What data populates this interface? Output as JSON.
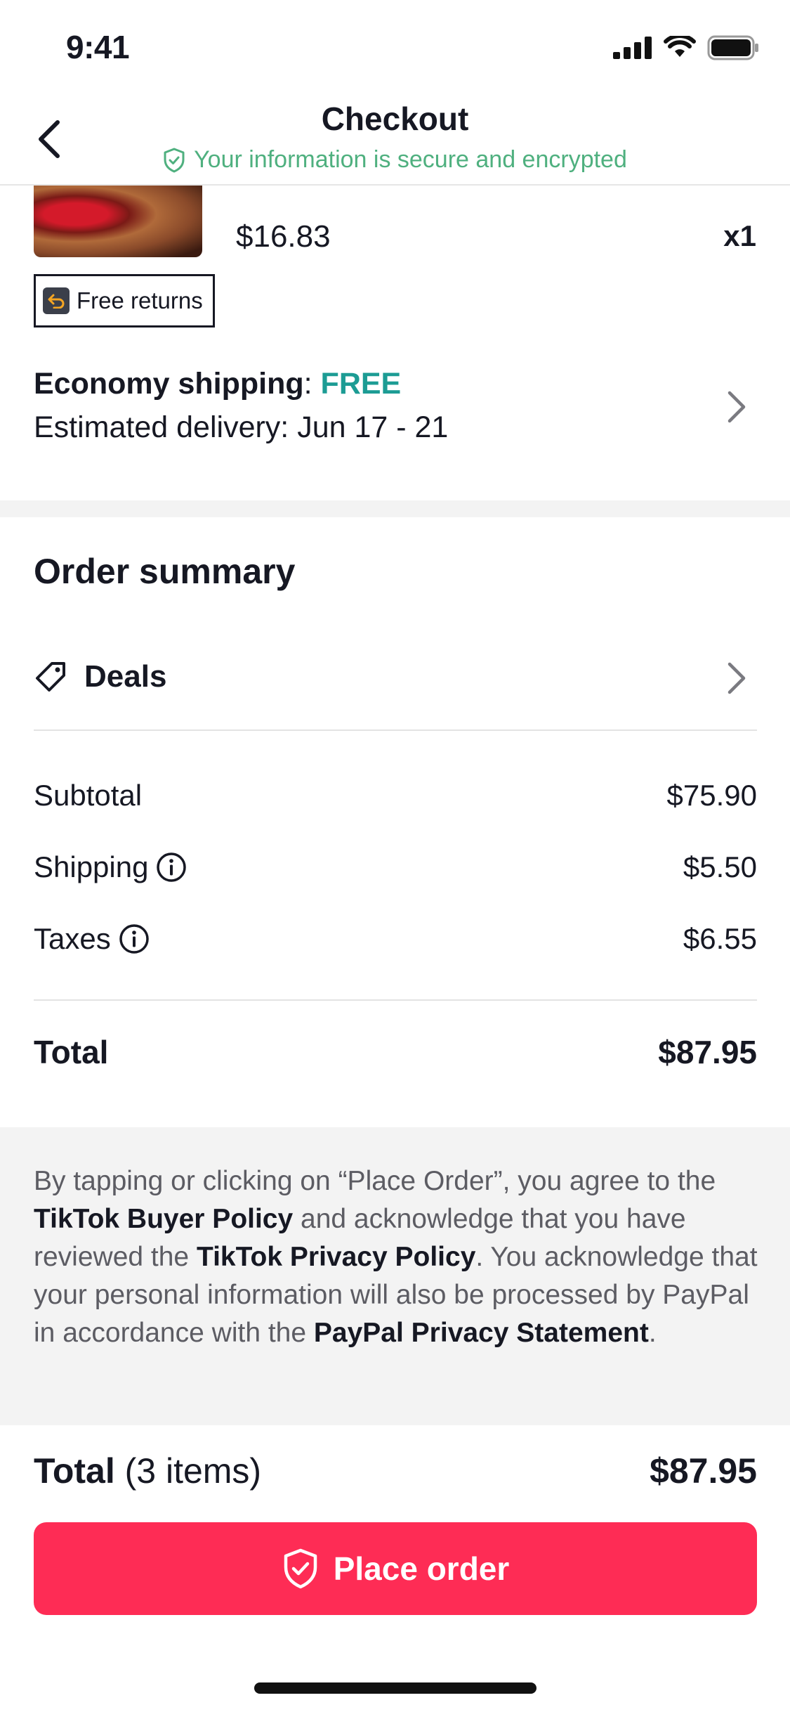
{
  "status_bar": {
    "time": "9:41"
  },
  "header": {
    "title": "Checkout",
    "secure_text": "Your information is secure and encrypted"
  },
  "product": {
    "price": "$16.83",
    "quantity": "x1",
    "free_returns": "Free returns"
  },
  "shipping": {
    "label": "Economy shipping",
    "separator": ": ",
    "cost": "FREE",
    "delivery": "Estimated delivery: Jun 17 - 21"
  },
  "summary": {
    "title": "Order summary",
    "deals_label": "Deals",
    "subtotal_label": "Subtotal",
    "subtotal_value": "$75.90",
    "shipping_label": "Shipping",
    "shipping_value": "$5.50",
    "taxes_label": "Taxes",
    "taxes_value": "$6.55",
    "total_label": "Total",
    "total_value": "$87.95"
  },
  "legal": {
    "part1": "By tapping or clicking on “Place Order”, you agree to the ",
    "link1": "TikTok Buyer Policy",
    "part2": " and acknowledge that you have reviewed the ",
    "link2": "TikTok Privacy Policy",
    "part3": ". You acknowledge that your personal information will also be processed by PayPal in accordance with the ",
    "link3": "PayPal Privacy Statement",
    "part4": "."
  },
  "footer": {
    "total_label": "Total",
    "items_count": " (3 items)",
    "total_value": "$87.95",
    "place_order": "Place order"
  },
  "colors": {
    "accent": "#fe2c55",
    "secure_green": "#4fb07f",
    "free_teal": "#1c9c94"
  }
}
